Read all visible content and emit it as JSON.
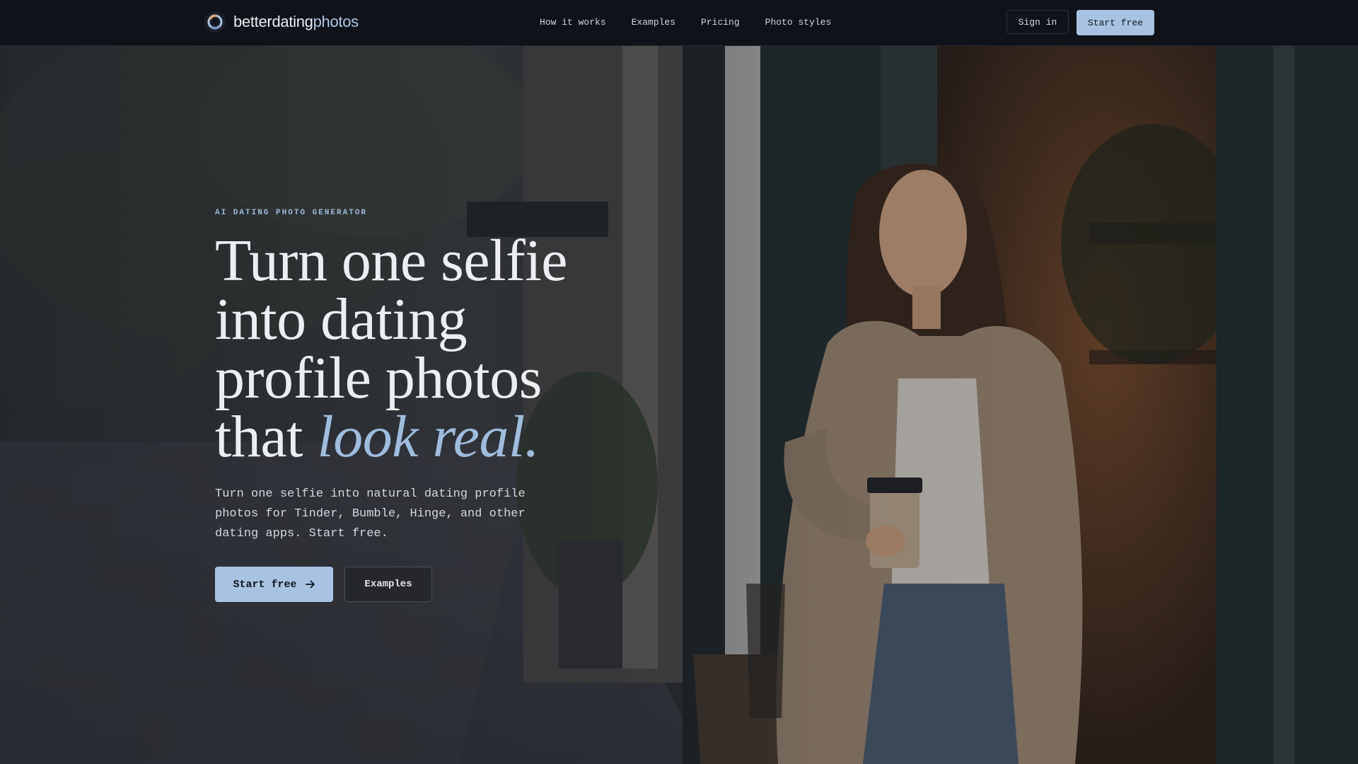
{
  "brand": {
    "name_part1": "betterdating",
    "name_part2": "photos",
    "colors": {
      "accent": "#a8c3e2",
      "nav_bg": "#0f1219",
      "headline": "#eceef2"
    }
  },
  "nav": {
    "links": [
      "How it works",
      "Examples",
      "Pricing",
      "Photo styles"
    ],
    "sign_in": "Sign in",
    "start_free": "Start free"
  },
  "hero": {
    "eyebrow": "AI DATING PHOTO GENERATOR",
    "headline": {
      "line1": "Turn one selfie",
      "line2": "into dating",
      "line3": "profile photos",
      "line4_plain": "that ",
      "line4_accent": "look real."
    },
    "subcopy": "Turn one selfie into natural dating profile photos for Tinder, Bumble, Hinge, and other dating apps. Start free.",
    "cta_primary": "Start free",
    "cta_primary_icon": "arrow-right-icon",
    "cta_secondary": "Examples",
    "background_image": "smiling woman in beige blazer holding coffee cup leaning in a cafe doorway"
  }
}
